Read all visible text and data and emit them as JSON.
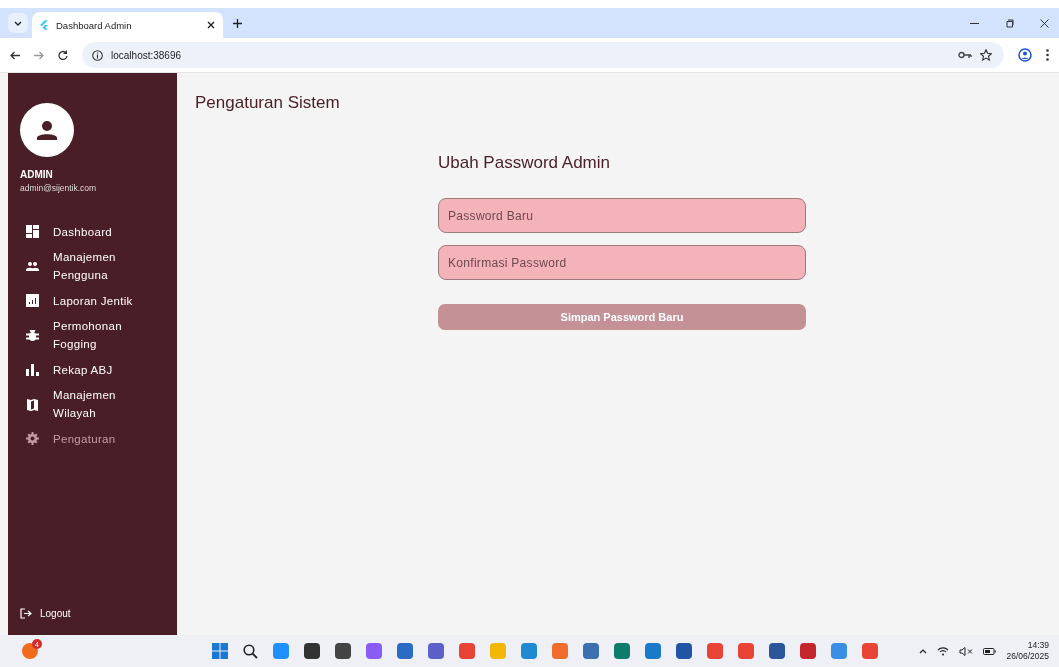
{
  "browser": {
    "tab_title": "Dashboard Admin",
    "url": "localhost:38696"
  },
  "sidebar": {
    "user_name": "ADMIN",
    "user_email": "admin@sijentik.com",
    "items": [
      {
        "label": "Dashboard",
        "selected": false
      },
      {
        "label": "Manajemen\nPengguna",
        "selected": false
      },
      {
        "label": "Laporan Jentik",
        "selected": false
      },
      {
        "label": "Permohonan\nFogging",
        "selected": false
      },
      {
        "label": "Rekap ABJ",
        "selected": false
      },
      {
        "label": "Manajemen\nWilayah",
        "selected": false
      },
      {
        "label": "Pengaturan",
        "selected": true
      }
    ],
    "logout": "Logout"
  },
  "page_title": "Pengaturan Sistem",
  "form": {
    "title": "Ubah Password Admin",
    "fields": [
      {
        "placeholder": "Password Baru"
      },
      {
        "placeholder": "Konfirmasi Password"
      }
    ],
    "submit": "Simpan Password Baru"
  },
  "taskbar": {
    "notification_badge": "4",
    "time": "14:39",
    "date": "26/06/2025"
  }
}
